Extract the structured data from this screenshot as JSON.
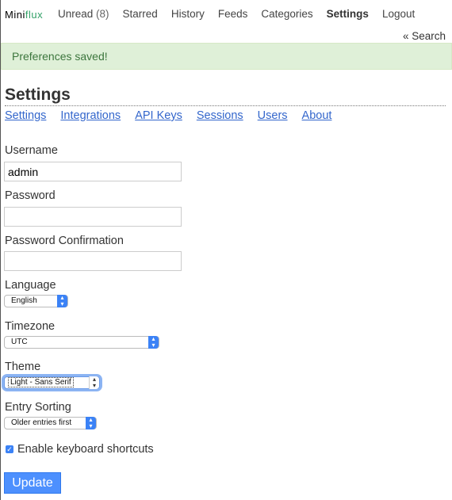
{
  "header": {
    "logo_prefix": "Mini",
    "logo_suffix": "flux",
    "nav": [
      {
        "label": "Unread",
        "count": "(8)"
      },
      {
        "label": "Starred"
      },
      {
        "label": "History"
      },
      {
        "label": "Feeds"
      },
      {
        "label": "Categories"
      },
      {
        "label": "Settings",
        "active": true
      },
      {
        "label": "Logout"
      }
    ],
    "search_link": "« Search"
  },
  "flash": {
    "message": "Preferences saved!"
  },
  "page": {
    "title": "Settings",
    "subnav": [
      "Settings",
      "Integrations",
      "API Keys",
      "Sessions",
      "Users",
      "About"
    ]
  },
  "form": {
    "username": {
      "label": "Username",
      "value": "admin"
    },
    "password": {
      "label": "Password",
      "value": ""
    },
    "password_confirmation": {
      "label": "Password Confirmation",
      "value": ""
    },
    "language": {
      "label": "Language",
      "selected": "English"
    },
    "timezone": {
      "label": "Timezone",
      "selected": "UTC"
    },
    "theme": {
      "label": "Theme",
      "selected": "Light - Sans Serif"
    },
    "entry_sorting": {
      "label": "Entry Sorting",
      "selected": "Older entries first"
    },
    "keyboard_shortcuts": {
      "label": "Enable keyboard shortcuts",
      "checked": true
    },
    "submit_label": "Update"
  },
  "colors": {
    "accent": "#33a168",
    "link": "#3366cc",
    "success_bg": "#dff0d8",
    "success_text": "#3c763d",
    "button": "#4d90fe"
  }
}
